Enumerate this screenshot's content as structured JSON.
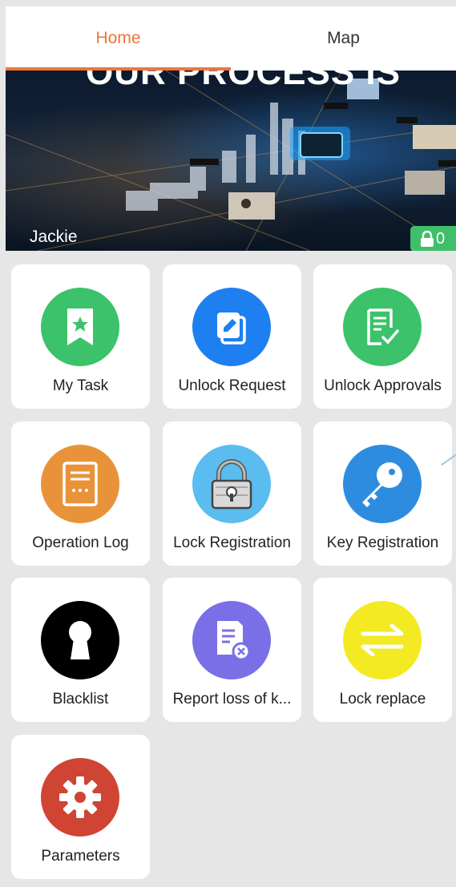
{
  "tabs": [
    {
      "label": "Home",
      "active": true
    },
    {
      "label": "Map",
      "active": false
    }
  ],
  "banner": {
    "headline": "OUR PROCESS IS",
    "user_name": "Jackie",
    "lock_count": "0"
  },
  "menu": [
    {
      "label": "My Task",
      "icon": "bookmark-star-icon",
      "color": "#3cc26a"
    },
    {
      "label": "Unlock Request",
      "icon": "edit-document-icon",
      "color": "#1e7ff0"
    },
    {
      "label": "Unlock Approvals",
      "icon": "checklist-icon",
      "color": "#3cc26a"
    },
    {
      "label": "Operation Log",
      "icon": "log-document-icon",
      "color": "#e8933a"
    },
    {
      "label": "Lock Registration",
      "icon": "padlock-icon",
      "color": "#5bbcf0"
    },
    {
      "label": "Key Registration",
      "icon": "key-icon",
      "color": "#2d8ce0"
    },
    {
      "label": "Blacklist",
      "icon": "keyhole-icon",
      "color": "#000000"
    },
    {
      "label": "Report loss of k...",
      "icon": "report-loss-icon",
      "color": "#7a6fe6"
    },
    {
      "label": "Lock replace",
      "icon": "swap-arrows-icon",
      "color": "#f3ea24"
    },
    {
      "label": "Parameters",
      "icon": "gear-icon",
      "color": "#cf4433"
    }
  ],
  "colors": {
    "accent": "#f0753a",
    "badge": "#3fbf6a",
    "background": "#e6e6e6"
  }
}
